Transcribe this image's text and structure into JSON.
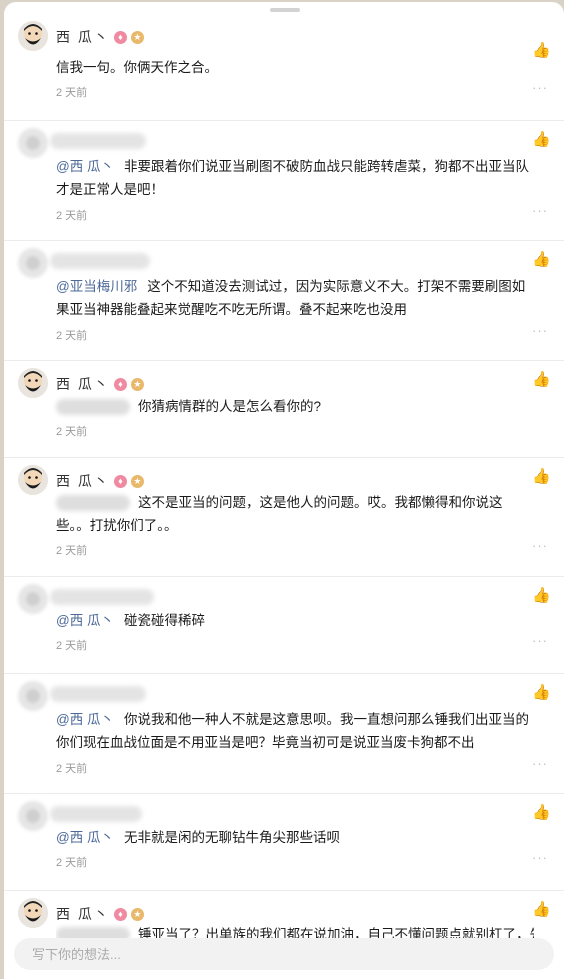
{
  "composer": {
    "placeholder": "写下你的想法..."
  },
  "comments": [
    {
      "author": "西 瓜丶",
      "text": "信我一句。你俩天作之合。",
      "time": "2 天前"
    },
    {
      "mention": "@西 瓜丶",
      "text": "非要跟着你们说亚当刷图不破防血战只能跨转虐菜，狗都不出亚当队才是正常人是吧！",
      "time": "2 天前"
    },
    {
      "mention": "@亚当梅川邪",
      "text": "这个不知道没去测试过，因为实际意义不大。打架不需要刷图如果亚当神器能叠起来觉醒吃不吃无所谓。叠不起来吃也没用",
      "time": "2 天前"
    },
    {
      "author": "西 瓜丶",
      "text": "你猜病情群的人是怎么看你的?",
      "time": "2 天前"
    },
    {
      "author": "西 瓜丶",
      "text": "这不是亚当的问题，这是他人的问题。哎。我都懒得和你说这些。。打扰你们了。。",
      "time": "2 天前"
    },
    {
      "mention": "@西 瓜丶",
      "text": "碰瓷碰得稀碎",
      "time": "2 天前"
    },
    {
      "mention": "@西 瓜丶",
      "text": "你说我和他一种人不就是这意思呗。我一直想问那么锤我们出亚当的你们现在血战位面是不用亚当是吧？毕竟当初可是说亚当废卡狗都不出",
      "time": "2 天前"
    },
    {
      "mention": "@西 瓜丶",
      "text": "无非就是闲的无聊钻牛角尖那些话呗",
      "time": "2 天前"
    },
    {
      "author": "西 瓜丶",
      "text": "锤亚当了？出单族的我们都在说加油，自己不懂问题点就别杠了，先",
      "time": ""
    }
  ],
  "icons": {
    "like": "thumbs-up-icon",
    "more": "more-dots-icon"
  },
  "more_label": "···"
}
